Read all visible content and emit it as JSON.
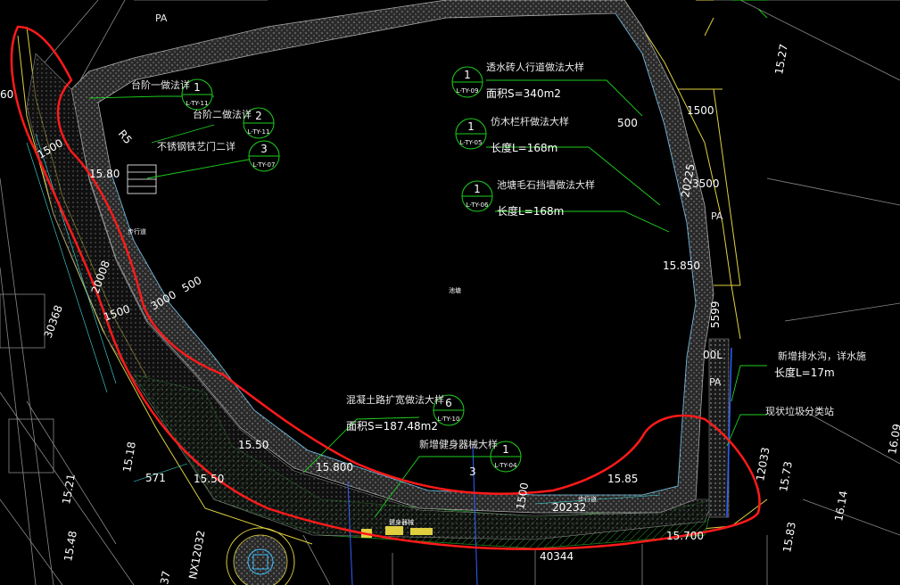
{
  "callouts": [
    {
      "num": "1",
      "ref": "L-TY-09",
      "title": "透水砖人行道做法大样",
      "detail": "面积S=340m2"
    },
    {
      "num": "1",
      "ref": "L-TY-05",
      "title": "仿木栏杆做法大样",
      "detail": "长度L=168m"
    },
    {
      "num": "1",
      "ref": "L-TY-06",
      "title": "池塘毛石挡墙做法大样",
      "detail": "长度L=168m"
    },
    {
      "num": "1",
      "ref": "L-TY-11",
      "title": "台阶一做法详",
      "detail": ""
    },
    {
      "num": "2",
      "ref": "L-TY-11",
      "title": "台阶二做法详",
      "detail": ""
    },
    {
      "num": "3",
      "ref": "L-TY-07",
      "title": "不锈钢铁艺门二详",
      "detail": ""
    },
    {
      "num": "6",
      "ref": "L-TY-10",
      "title": "混凝土路扩宽做法大样",
      "detail": "面积S=187.48m2"
    },
    {
      "num": "1",
      "ref": "L-TY-04",
      "title": "新增健身器械大样",
      "detail": ""
    }
  ],
  "right_notes": {
    "drain": "新增排水沟，详水施",
    "drain_length": "长度L=17m",
    "pump": "现状垃圾分类站"
  },
  "labels": {
    "pa1": "PA",
    "pa2": "PA",
    "pa3": "PA",
    "pond": "池塘",
    "step_tag": "步行道",
    "step_tag2": "步行道",
    "fitness": "健身器械",
    "elev_1580": "15.80",
    "elev_15850": "15.850",
    "elev_1550a": "15.50",
    "elev_1550b": "15.50",
    "elev_15800": "15.800",
    "elev_1585": "15.85",
    "elev_15700": "15.700",
    "elev_1521": "15.21",
    "elev_1548": "15.48",
    "elev_1527": "15.27",
    "elev_1573": "15.73",
    "elev_1614": "16.14",
    "elev_1609": "16.09",
    "elev_1583": "15.83",
    "elev_1518": "15.18",
    "dim_1500a": "1500",
    "dim_1500b": "1500",
    "dim_1500c": "1500",
    "dim_3000": "3000",
    "dim_500a": "500",
    "dim_500b": "500",
    "dim_3500": "3500",
    "dim_20225": "20225",
    "dim_20008": "20008",
    "dim_30368": "30368",
    "dim_20232": "20232",
    "dim_5599": "5599",
    "dim_571": "571",
    "dim_40344": "40344",
    "dim_12033": "12033",
    "nx": "NX12032",
    "num_3": "3",
    "num_37": "37",
    "num_60": "60",
    "r5": "R5",
    "ol": "00L"
  }
}
